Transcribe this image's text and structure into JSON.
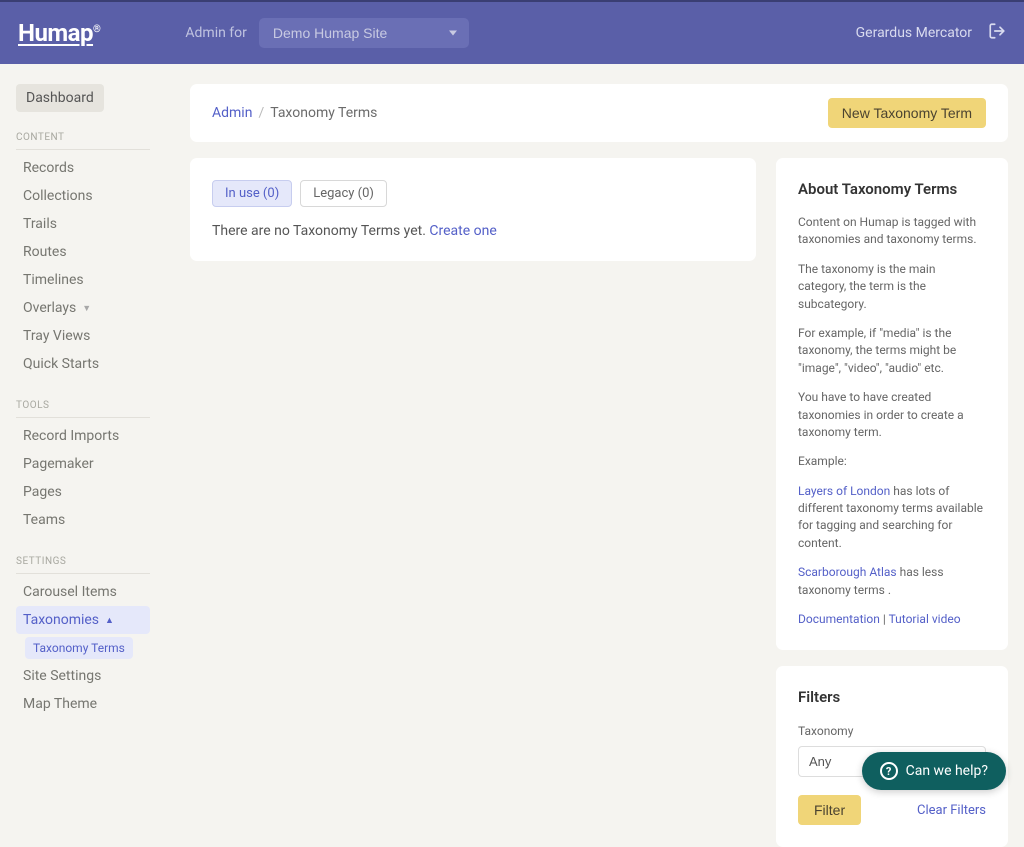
{
  "header": {
    "logo": "Humap",
    "admin_for_label": "Admin for",
    "site_selected": "Demo Humap Site",
    "username": "Gerardus Mercator"
  },
  "sidebar": {
    "dashboard": "Dashboard",
    "sections": [
      {
        "label": "CONTENT",
        "items": [
          {
            "label": "Records",
            "name": "records"
          },
          {
            "label": "Collections",
            "name": "collections"
          },
          {
            "label": "Trails",
            "name": "trails"
          },
          {
            "label": "Routes",
            "name": "routes"
          },
          {
            "label": "Timelines",
            "name": "timelines"
          },
          {
            "label": "Overlays",
            "name": "overlays",
            "caret": "down"
          },
          {
            "label": "Tray Views",
            "name": "tray-views"
          },
          {
            "label": "Quick Starts",
            "name": "quick-starts"
          }
        ]
      },
      {
        "label": "TOOLS",
        "items": [
          {
            "label": "Record Imports",
            "name": "record-imports"
          },
          {
            "label": "Pagemaker",
            "name": "pagemaker"
          },
          {
            "label": "Pages",
            "name": "pages"
          },
          {
            "label": "Teams",
            "name": "teams"
          }
        ]
      },
      {
        "label": "SETTINGS",
        "items": [
          {
            "label": "Carousel Items",
            "name": "carousel-items"
          },
          {
            "label": "Taxonomies",
            "name": "taxonomies",
            "caret": "up",
            "active": true,
            "sub": "Taxonomy Terms"
          },
          {
            "label": "Site Settings",
            "name": "site-settings"
          },
          {
            "label": "Map Theme",
            "name": "map-theme"
          }
        ]
      }
    ]
  },
  "breadcrumb": {
    "root": "Admin",
    "sep": "/",
    "current": "Taxonomy Terms",
    "new_button": "New Taxonomy Term"
  },
  "tabs": {
    "in_use": "In use (0)",
    "legacy": "Legacy (0)"
  },
  "empty": {
    "text": "There are no Taxonomy Terms yet. ",
    "link": "Create one"
  },
  "about": {
    "title": "About Taxonomy Terms",
    "p1": "Content on Humap is tagged with taxonomies and taxonomy terms.",
    "p2": "The taxonomy is the main category, the term is the subcategory.",
    "p3": "For example, if \"media\" is the taxonomy, the terms might be \"image\", \"video\", \"audio\" etc.",
    "p4": "You have to have created taxonomies in order to create a taxonomy term.",
    "p5": "Example:",
    "ex1_link": "Layers of London",
    "ex1_rest": " has lots of different taxonomy terms available for tagging and searching for content.",
    "ex2_link": "Scarborough Atlas",
    "ex2_rest": " has less taxonomy terms .",
    "doc_link": "Documentation",
    "doc_sep": " | ",
    "tut_link": "Tutorial video"
  },
  "filters": {
    "title": "Filters",
    "taxonomy_label": "Taxonomy",
    "taxonomy_value": "Any",
    "filter_btn": "Filter",
    "clear": "Clear Filters"
  },
  "help": {
    "label": "Can we help?"
  }
}
